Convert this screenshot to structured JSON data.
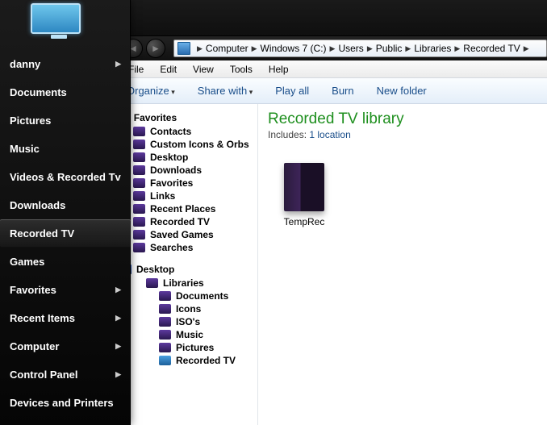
{
  "start_panel": {
    "items": [
      {
        "label": "danny",
        "arrow": true,
        "selected": false
      },
      {
        "label": "Documents",
        "arrow": false,
        "selected": false
      },
      {
        "label": "Pictures",
        "arrow": false,
        "selected": false
      },
      {
        "label": "Music",
        "arrow": false,
        "selected": false
      },
      {
        "label": "Videos & Recorded Tv",
        "arrow": false,
        "selected": false
      },
      {
        "label": "Downloads",
        "arrow": false,
        "selected": false
      },
      {
        "label": "Recorded TV",
        "arrow": false,
        "selected": true
      },
      {
        "label": "Games",
        "arrow": false,
        "selected": false
      },
      {
        "label": "Favorites",
        "arrow": true,
        "selected": false
      },
      {
        "label": "Recent Items",
        "arrow": true,
        "selected": false
      },
      {
        "label": "Computer",
        "arrow": true,
        "selected": false
      },
      {
        "label": "Control Panel",
        "arrow": true,
        "selected": false
      },
      {
        "label": "Devices and Printers",
        "arrow": false,
        "selected": false
      }
    ]
  },
  "breadcrumb": {
    "parts": [
      "Computer",
      "Windows 7 (C:)",
      "Users",
      "Public",
      "Libraries",
      "Recorded TV"
    ]
  },
  "menubar": {
    "file": "File",
    "edit": "Edit",
    "view": "View",
    "tools": "Tools",
    "help": "Help"
  },
  "toolbar": {
    "organize": "Organize",
    "share": "Share with",
    "playall": "Play all",
    "burn": "Burn",
    "newfolder": "New folder"
  },
  "nav": {
    "favorites_label": "Favorites",
    "favorites": [
      "Contacts",
      "Custom Icons & Orbs",
      "Desktop",
      "Downloads",
      "Favorites",
      "Links",
      "Recent Places",
      "Recorded TV",
      "Saved Games",
      "Searches"
    ],
    "desktop_label": "Desktop",
    "libraries_label": "Libraries",
    "libraries": [
      "Documents",
      "Icons",
      "ISO's",
      "Music",
      "Pictures",
      "Recorded TV"
    ]
  },
  "library": {
    "title": "Recorded TV library",
    "includes_prefix": "Includes:  ",
    "includes_link": "1 location"
  },
  "files": [
    {
      "name": "TempRec"
    }
  ]
}
